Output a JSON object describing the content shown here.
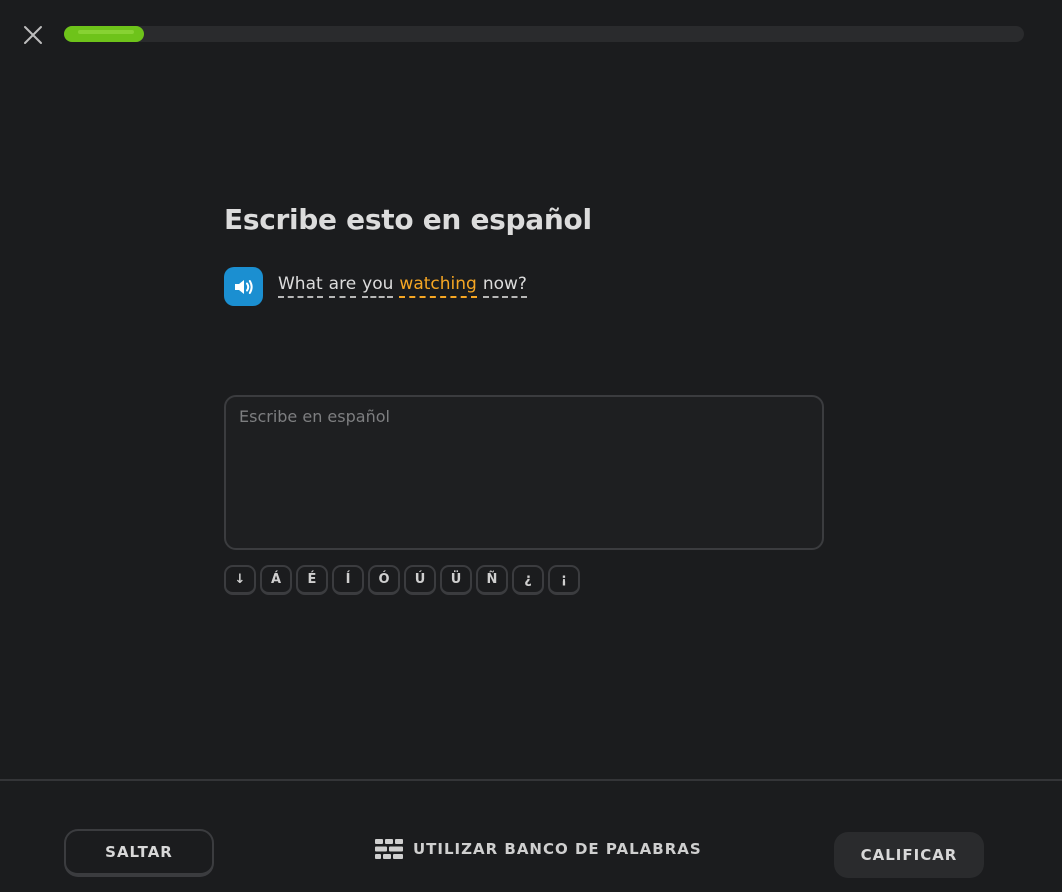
{
  "header": {
    "close_icon": "close-icon",
    "progress_fraction": 0.083,
    "progress_color": "#6ec31a"
  },
  "prompt": {
    "title": "Escribe esto en español",
    "speaker_icon": "speaker-icon",
    "speaker_color": "#1b8fd1",
    "sentence_words": [
      "What",
      "are",
      "you",
      "watching",
      "now?"
    ],
    "highlighted_word": "watching",
    "highlight_color": "#f6a623"
  },
  "answer": {
    "placeholder": "Escribe en español",
    "value": ""
  },
  "special_keys": [
    "↓",
    "Á",
    "É",
    "Í",
    "Ó",
    "Ú",
    "Ü",
    "Ñ",
    "¿",
    "¡"
  ],
  "footer": {
    "skip_label": "SALTAR",
    "wordbank_label": "UTILIZAR BANCO DE PALABRAS",
    "wordbank_icon": "word-bank-icon",
    "check_label": "CALIFICAR"
  }
}
